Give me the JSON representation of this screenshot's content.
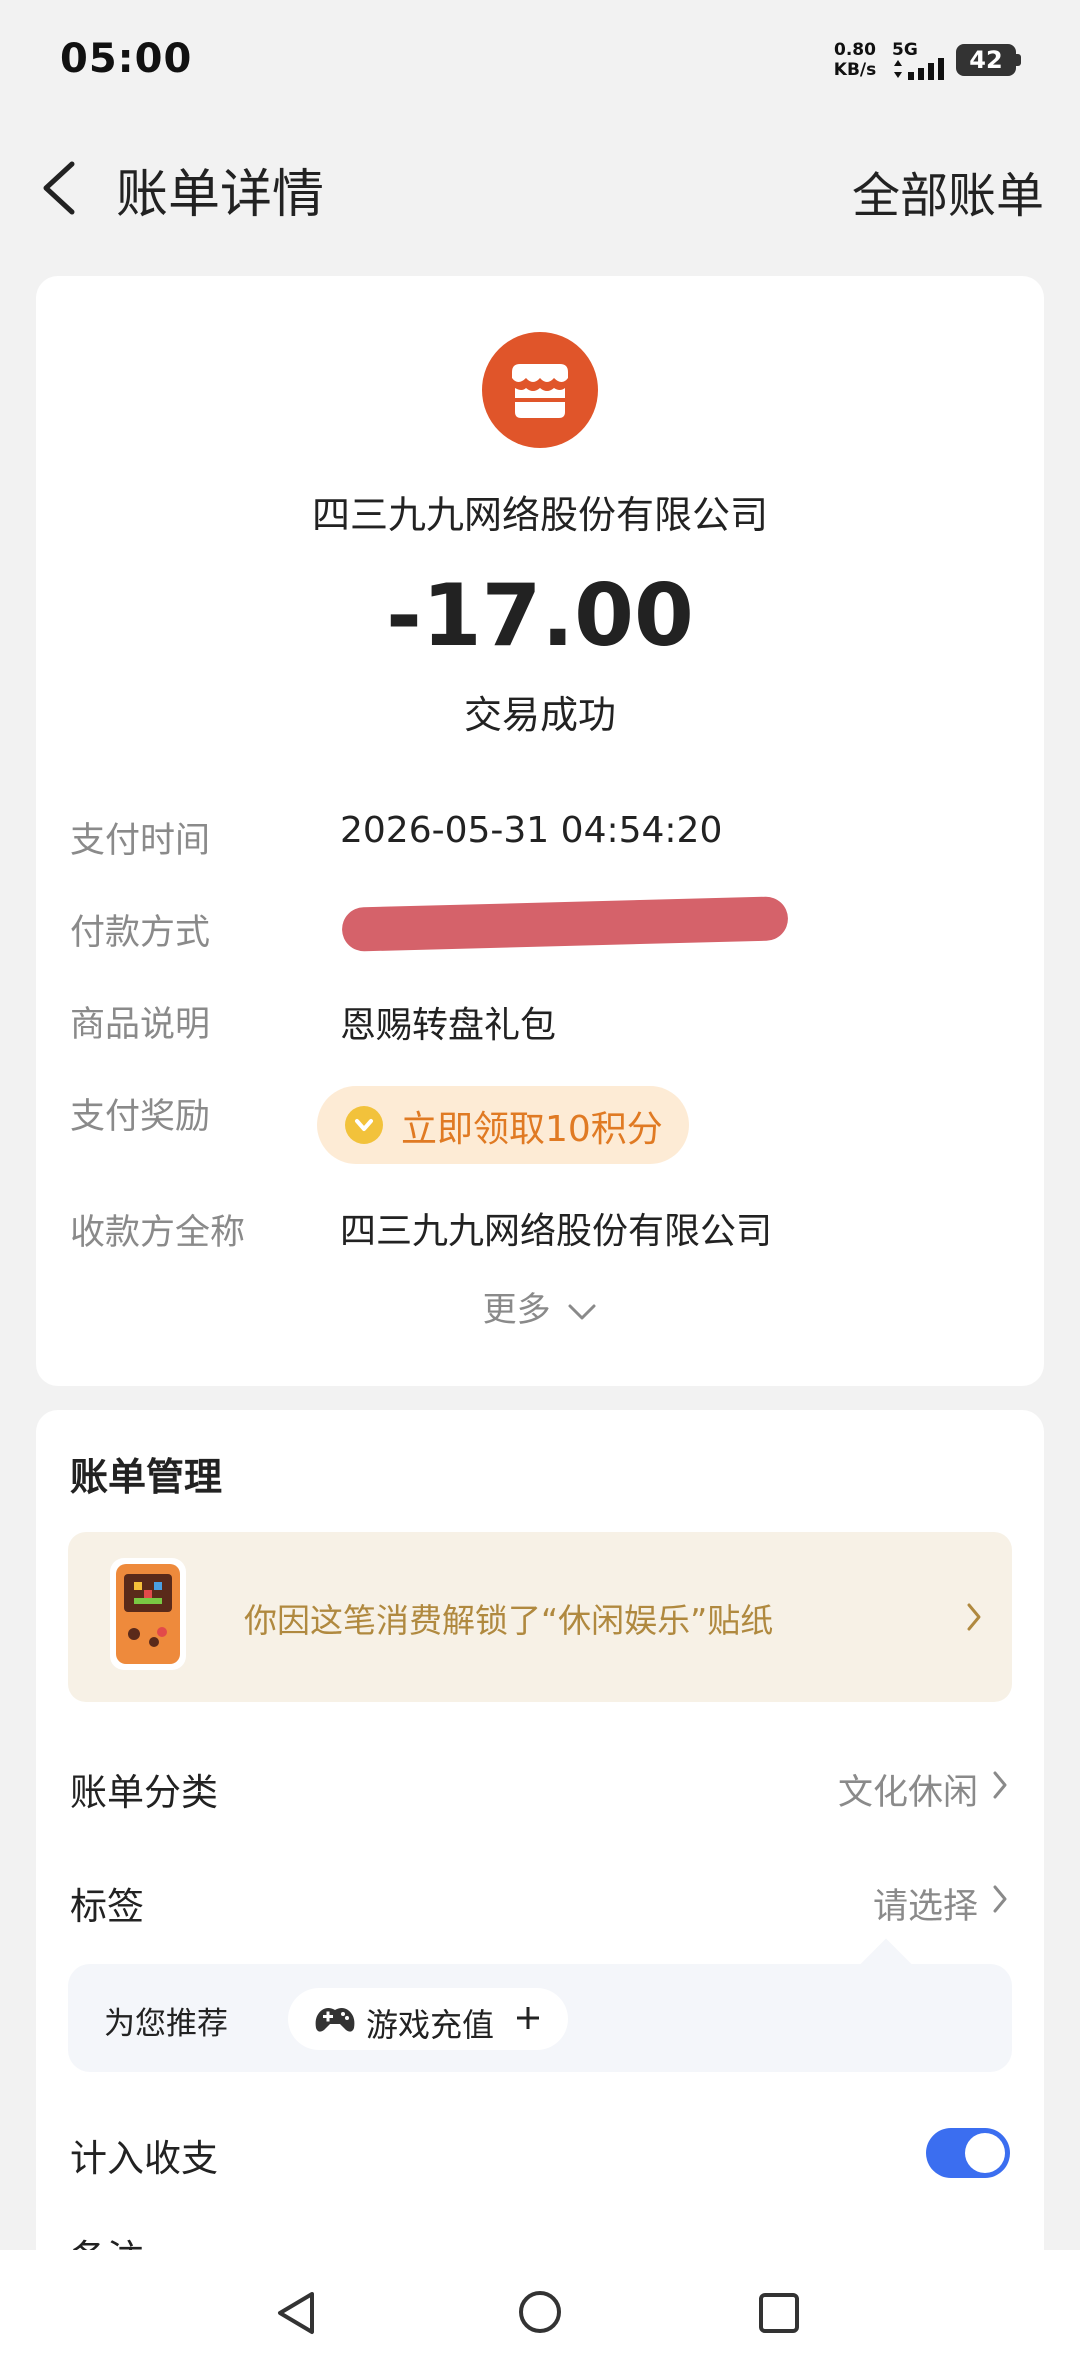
{
  "status_bar": {
    "time": "05:00",
    "net_speed_value": "0.80",
    "net_speed_unit": "KB/s",
    "network_type": "5G",
    "battery_level": "42"
  },
  "header": {
    "title": "账单详情",
    "all_bills_label": "全部账单"
  },
  "transaction": {
    "merchant_name": "四三九九网络股份有限公司",
    "amount": "-17.00",
    "status": "交易成功",
    "rows": {
      "pay_time_label": "支付时间",
      "pay_time_value": "2026-05-31 04:54:20",
      "pay_method_label": "付款方式",
      "product_label": "商品说明",
      "product_value": "恩赐转盘礼包",
      "reward_label": "支付奖励",
      "reward_value": "立即领取10积分",
      "payee_label": "收款方全称",
      "payee_value": "四三九九网络股份有限公司"
    },
    "more_label": "更多"
  },
  "management": {
    "title": "账单管理",
    "sticker_text": "你因这笔消费解锁了“休闲娱乐”贴纸",
    "category_label": "账单分类",
    "category_value": "文化休闲",
    "tag_label": "标签",
    "tag_value": "请选择",
    "recommend_label": "为您推荐",
    "recommend_chip": "游戏充值",
    "include_label": "计入收支",
    "include_enabled": true,
    "note_label": "备注"
  },
  "colors": {
    "merchant_logo": "#e0552a",
    "reward_bg": "#fdebd5",
    "reward_text": "#e07a23",
    "sticker_bg": "#f7f1e6",
    "sticker_text": "#b0893f",
    "toggle_on": "#3b6ef0"
  },
  "icons": [
    "back-arrow-icon",
    "store-icon",
    "coin-icon",
    "chevron-down-icon",
    "sticker-icon",
    "chevron-right-icon",
    "gamepad-icon",
    "plus-icon",
    "nav-back-icon",
    "nav-home-icon",
    "nav-recent-icon"
  ]
}
